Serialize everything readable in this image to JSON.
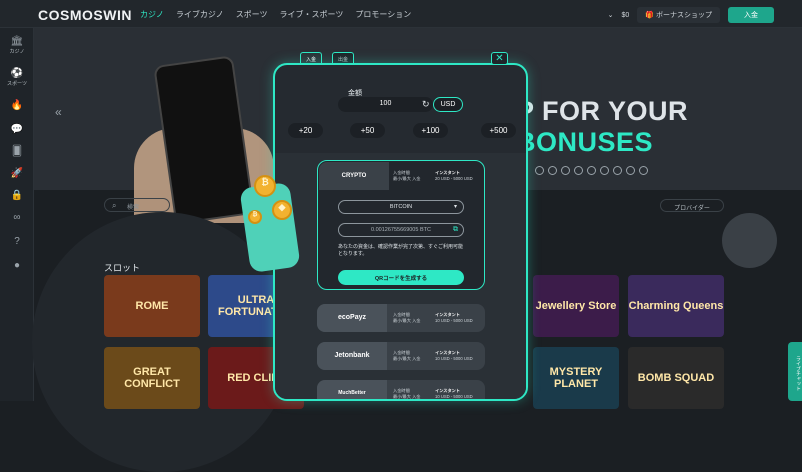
{
  "header": {
    "logo": "COSMOSWIN",
    "nav": [
      "カジノ",
      "ライブカジノ",
      "スポーツ",
      "ライブ・スポーツ",
      "プロモーション"
    ],
    "balance": "$0",
    "shop_label": "ボーナスショップ",
    "deposit_label": "入金"
  },
  "sidebar": {
    "items": [
      {
        "icon": "casino-icon",
        "label": "カジノ"
      },
      {
        "icon": "sports-icon",
        "label": "スポーツ"
      }
    ]
  },
  "banner": {
    "headline_start": "P FOR YOUR ",
    "headline_accent": "BONUSES"
  },
  "lobby": {
    "search_placeholder": "検索",
    "provider_label": "プロバイダー",
    "slots_label": "スロット",
    "games": [
      "ROME",
      "ULTRA FORTUNATOR",
      "Jewellery Store",
      "Charming Queens",
      "GREAT CONFLICT",
      "RED CLIFF",
      "MYSTERY PLANET",
      "BOMB SQUAD"
    ]
  },
  "side_tab": "ライブチャット",
  "modal": {
    "tab_deposit": "入金",
    "tab_withdraw": "出金",
    "amount_label": "金額",
    "amount_value": "100",
    "currency": "USD",
    "quick_amounts": [
      "+20",
      "+50",
      "+100",
      "+500"
    ],
    "methods": [
      {
        "name": "CRYPTO",
        "label1": "入金時間",
        "label2": "最小/最大 入金",
        "val1": "インスタント",
        "val2": "20 USD - 5000 USD"
      },
      {
        "name": "ecoPayz",
        "label1": "入金時間",
        "label2": "最小/最大 入金",
        "val1": "インスタント",
        "val2": "10 USD - 5000 USD"
      },
      {
        "name": "Jetonbank",
        "label1": "入金時間",
        "label2": "最小/最大 入金",
        "val1": "インスタント",
        "val2": "10 USD - 5000 USD"
      },
      {
        "name": "MuchBetter",
        "label1": "入金時間",
        "label2": "最小/最大 入金",
        "val1": "インスタント",
        "val2": "10 USD - 5000 USD"
      }
    ],
    "coin_select": "BITCOIN",
    "btc_amount": "0.00126755669005 BTC",
    "note": "あなたの資金は、確認作業が完了次第、すぐご利用可能となります。",
    "qr_button": "QRコードを生成する"
  },
  "colors": {
    "accent": "#2ee8c5",
    "background": "#1b1f23"
  }
}
